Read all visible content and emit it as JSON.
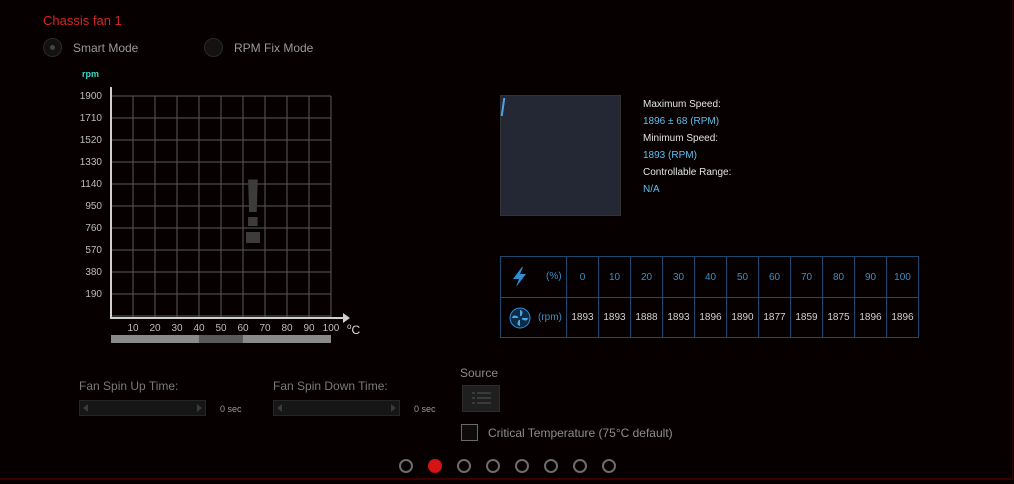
{
  "title": "Chassis fan 1",
  "modes": [
    {
      "label": "Smart Mode",
      "selected": true
    },
    {
      "label": "RPM Fix Mode",
      "selected": false
    }
  ],
  "chart_data": {
    "type": "line",
    "ylabel": "rpm",
    "xlabel": "°C",
    "y_ticks": [
      "1900",
      "1710",
      "1520",
      "1330",
      "1140",
      "950",
      "760",
      "570",
      "380",
      "190"
    ],
    "x_ticks": [
      "10",
      "20",
      "30",
      "40",
      "50",
      "60",
      "70",
      "80",
      "90",
      "100"
    ],
    "grid": true,
    "warning_glyph": "!",
    "series": []
  },
  "speed_info": {
    "max_label": "Maximum Speed:",
    "max_value": "1896 ± 68 (RPM)",
    "min_label": "Minimum Speed:",
    "min_value": "1893 (RPM)",
    "range_label": "Controllable Range:",
    "range_value": "N/A"
  },
  "speed_table": {
    "power_icon": "lightning-icon",
    "fan_icon": "fan-icon",
    "percent_unit": "(%)",
    "rpm_unit": "(rpm)",
    "percent": [
      "0",
      "10",
      "20",
      "30",
      "40",
      "50",
      "60",
      "70",
      "80",
      "90",
      "100"
    ],
    "rpm": [
      "1893",
      "1893",
      "1888",
      "1893",
      "1896",
      "1890",
      "1877",
      "1859",
      "1875",
      "1896",
      "1896"
    ]
  },
  "spin_up": {
    "label": "Fan Spin Up Time:",
    "value": "0 sec"
  },
  "spin_down": {
    "label": "Fan Spin Down Time:",
    "value": "0 sec"
  },
  "source": {
    "label": "Source",
    "icon": "list-icon"
  },
  "critical_temp": {
    "label": "Critical Temperature (75°C default)",
    "checked": false
  },
  "pager": {
    "count": 8,
    "active_index": 1
  },
  "colors": {
    "accent_red": "#d42626",
    "table_blue": "#3a8ec8",
    "value_cyan": "#5ec1f0",
    "rpm_teal": "#3fd6c8"
  }
}
